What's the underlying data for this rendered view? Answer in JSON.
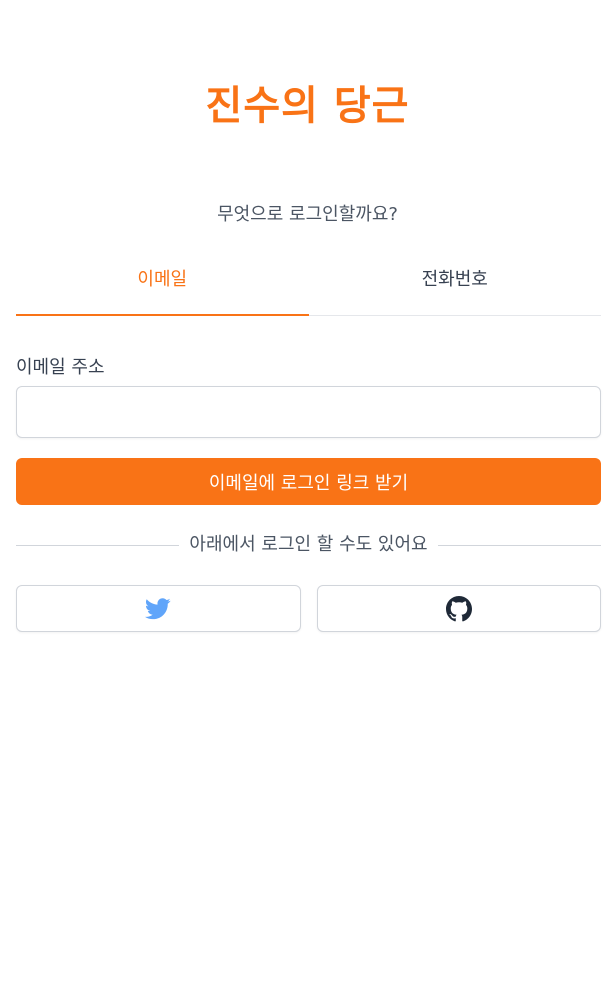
{
  "brand": {
    "title": "진수의 당근"
  },
  "login": {
    "subtitle": "무엇으로 로그인할까요?",
    "tabs": [
      {
        "label": "이메일",
        "active": true
      },
      {
        "label": "전화번호",
        "active": false
      }
    ],
    "email_label": "이메일 주소",
    "email_value": "",
    "email_placeholder": "",
    "submit_label": "이메일에 로그인 링크 받기",
    "divider_text": "아래에서 로그인 할 수도 있어요"
  },
  "social": [
    {
      "icon": "twitter-icon",
      "color": "#60a5fa"
    },
    {
      "icon": "github-icon",
      "color": "#1f2937"
    }
  ],
  "colors": {
    "accent": "#f97316",
    "border": "#d1d5db",
    "text": "#374151"
  }
}
